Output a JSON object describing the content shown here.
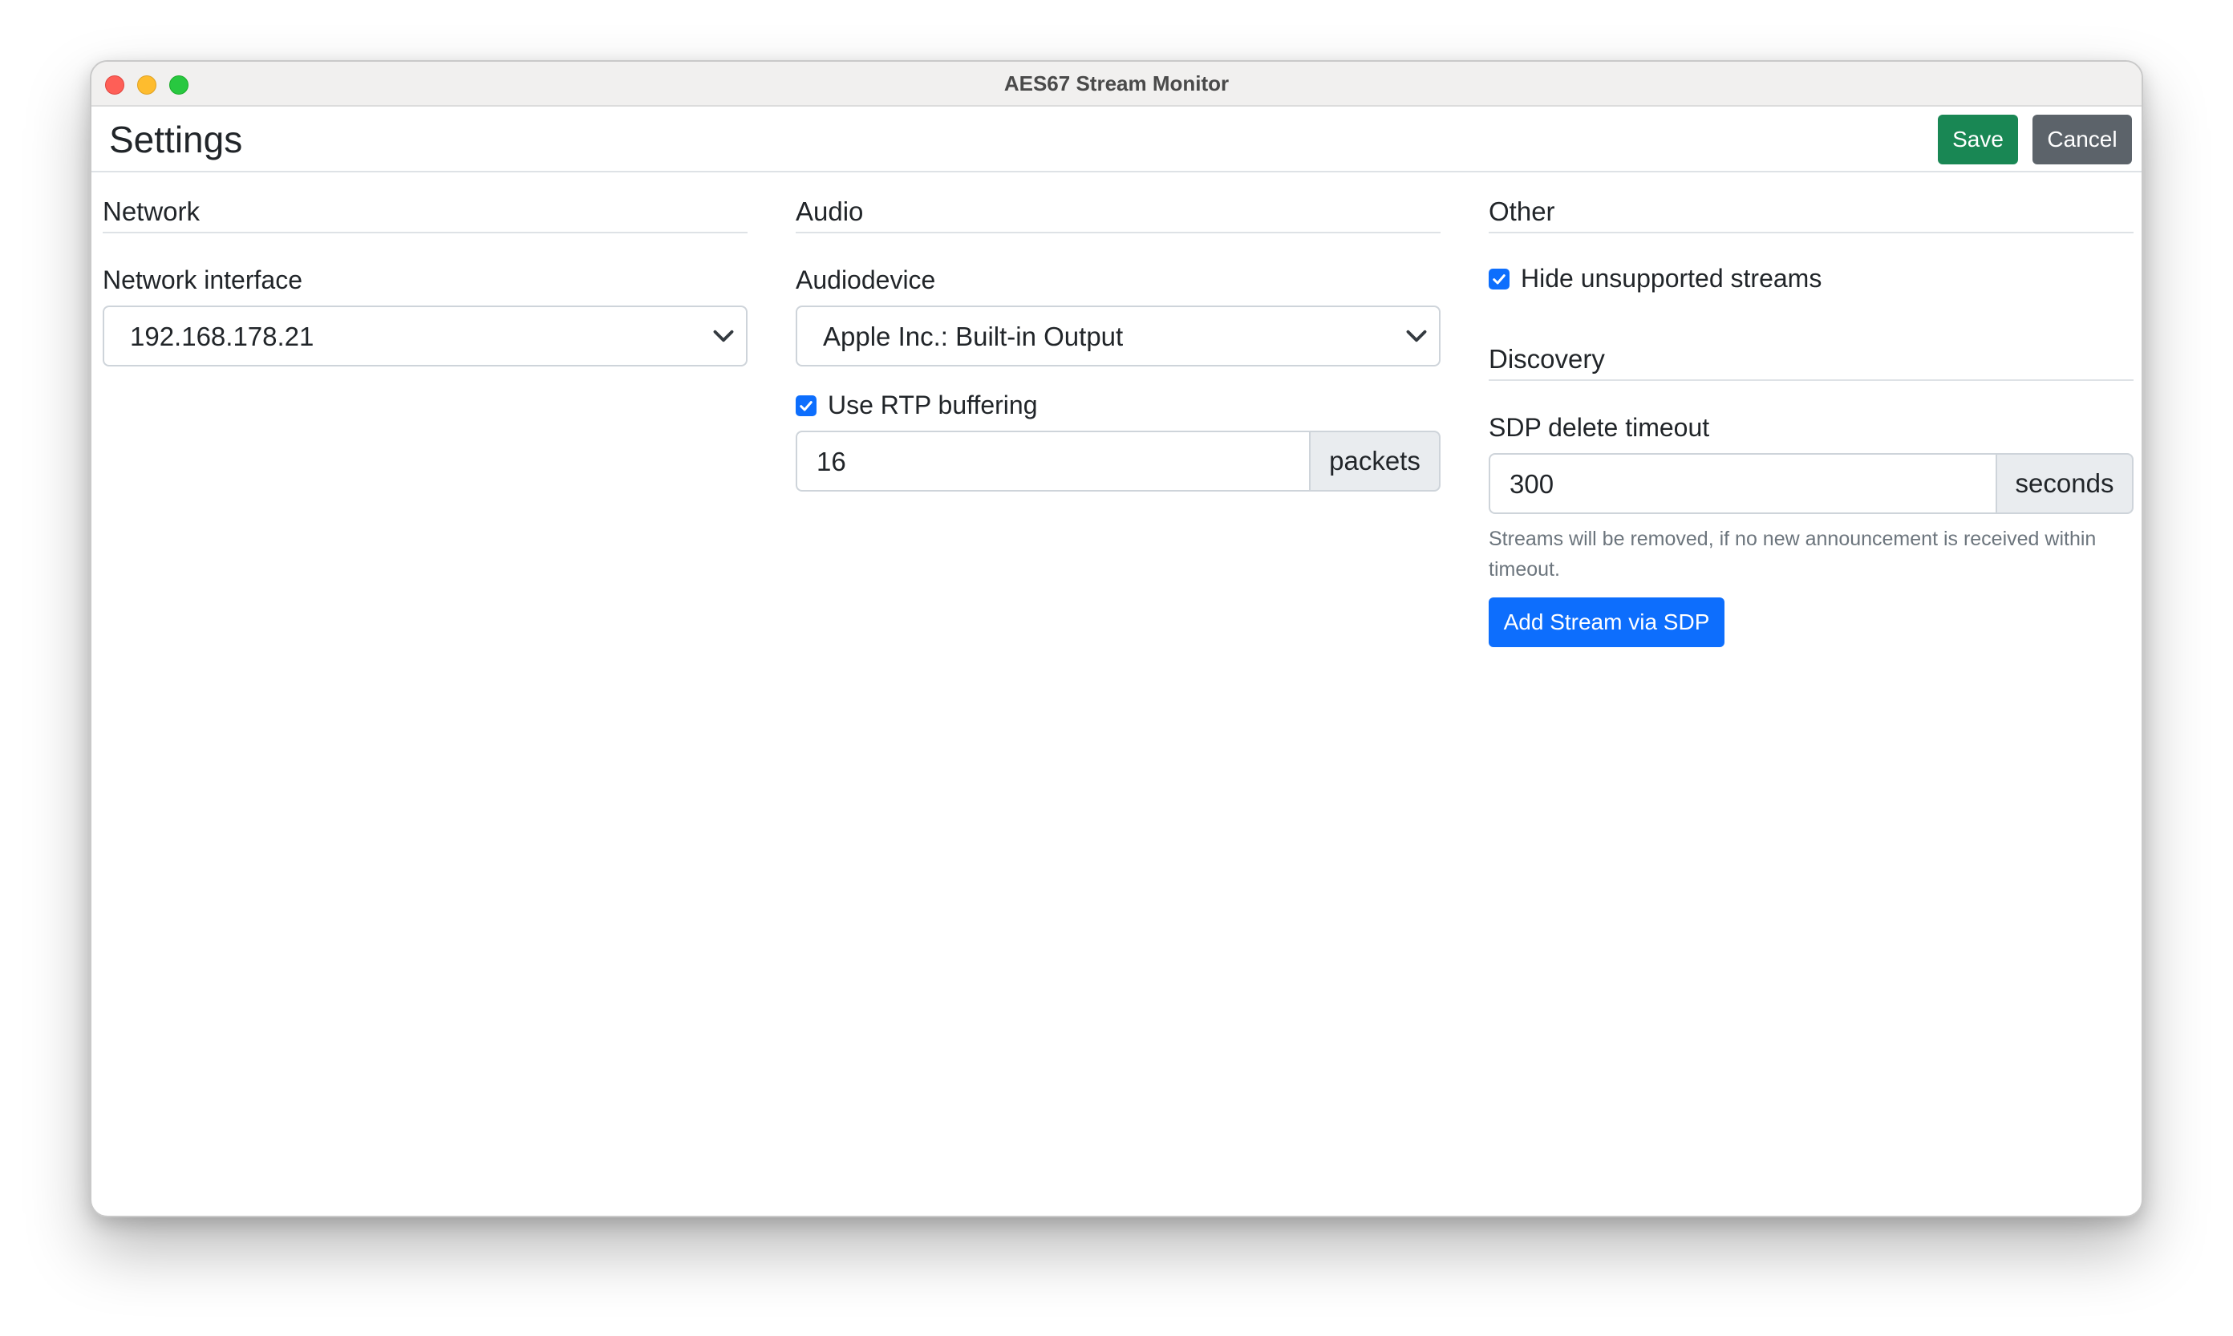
{
  "window": {
    "title": "AES67 Stream Monitor"
  },
  "header": {
    "title": "Settings",
    "save_label": "Save",
    "cancel_label": "Cancel"
  },
  "network": {
    "section_title": "Network",
    "interface_label": "Network interface",
    "interface_value": "192.168.178.21"
  },
  "audio": {
    "section_title": "Audio",
    "device_label": "Audiodevice",
    "device_value": "Apple Inc.: Built-in Output",
    "rtp_buffering_label": "Use RTP buffering",
    "rtp_buffering_checked": true,
    "buffer_value": "16",
    "buffer_unit": "packets"
  },
  "other": {
    "section_title": "Other",
    "hide_unsupported_label": "Hide unsupported streams",
    "hide_unsupported_checked": true
  },
  "discovery": {
    "section_title": "Discovery",
    "sdp_timeout_label": "SDP delete timeout",
    "sdp_timeout_value": "300",
    "sdp_timeout_unit": "seconds",
    "help_text": "Streams will be removed, if no new announcement is received within timeout.",
    "add_stream_label": "Add Stream via SDP"
  },
  "colors": {
    "primary": "#0d6efd",
    "success": "#198754",
    "secondary": "#5c636a"
  }
}
